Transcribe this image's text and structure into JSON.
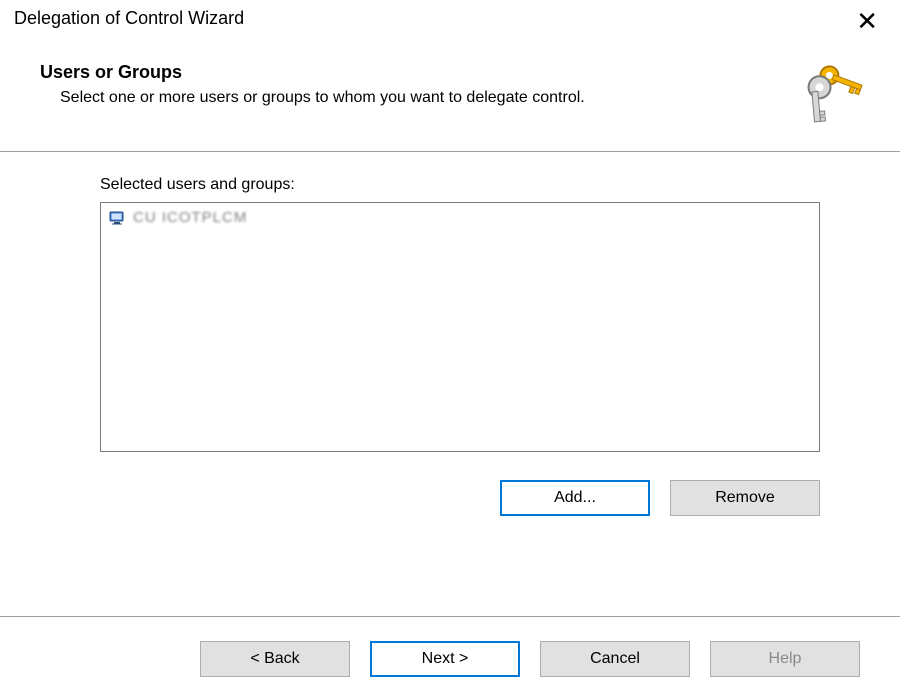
{
  "window": {
    "title": "Delegation of Control Wizard"
  },
  "header": {
    "page_title": "Users or Groups",
    "description": "Select one or more users or groups to whom you want to delegate control."
  },
  "list": {
    "label": "Selected users and groups:",
    "items": [
      {
        "display": "CU ICOTPLCM"
      }
    ]
  },
  "buttons": {
    "add": "Add...",
    "remove": "Remove",
    "back": "< Back",
    "next": "Next >",
    "cancel": "Cancel",
    "help": "Help"
  }
}
